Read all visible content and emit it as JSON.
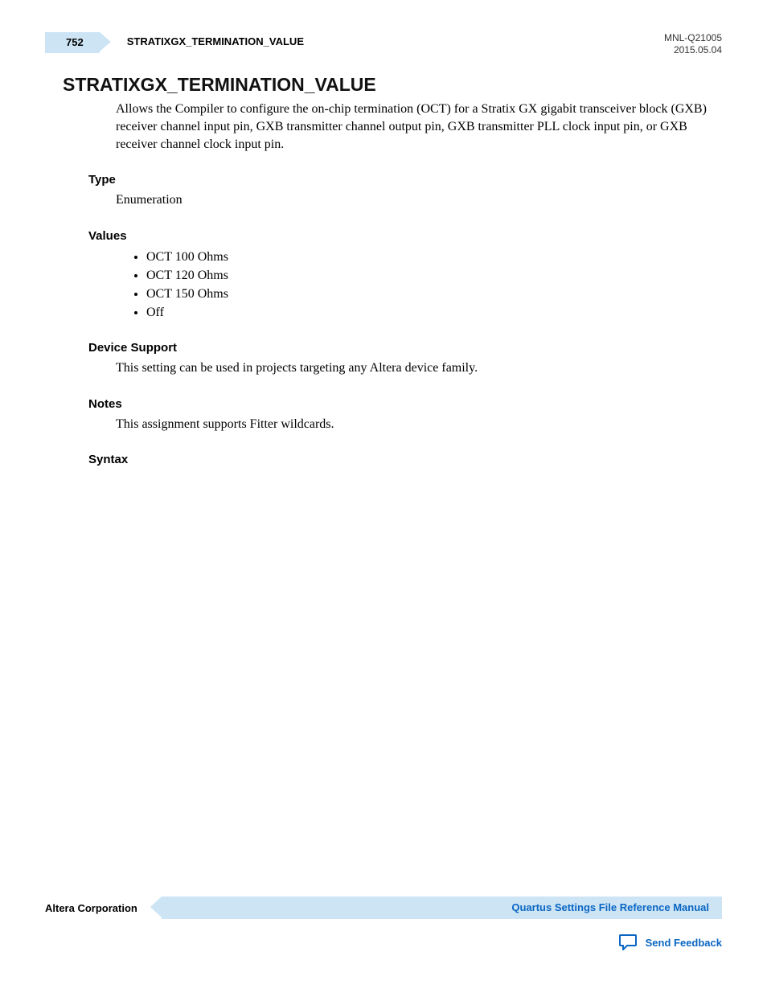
{
  "header": {
    "page_number": "752",
    "running_title": "STRATIXGX_TERMINATION_VALUE",
    "doc_id": "MNL-Q21005",
    "date": "2015.05.04"
  },
  "title": "STRATIXGX_TERMINATION_VALUE",
  "intro": "Allows the Compiler to configure the on-chip termination (OCT) for a Stratix GX gigabit transceiver block (GXB) receiver channel input pin, GXB transmitter channel output pin, GXB transmitter PLL clock input pin, or GXB receiver channel clock input pin.",
  "sections": {
    "type": {
      "label": "Type",
      "body": "Enumeration"
    },
    "values": {
      "label": "Values",
      "items": [
        "OCT 100 Ohms",
        "OCT 120 Ohms",
        "OCT 150 Ohms",
        "Off"
      ]
    },
    "device_support": {
      "label": "Device Support",
      "body": "This setting can be used in projects targeting any Altera device family."
    },
    "notes": {
      "label": "Notes",
      "body": "This assignment supports Fitter wildcards."
    },
    "syntax": {
      "label": "Syntax"
    }
  },
  "footer": {
    "company": "Altera Corporation",
    "manual_link": "Quartus Settings File Reference Manual",
    "feedback": "Send Feedback"
  }
}
